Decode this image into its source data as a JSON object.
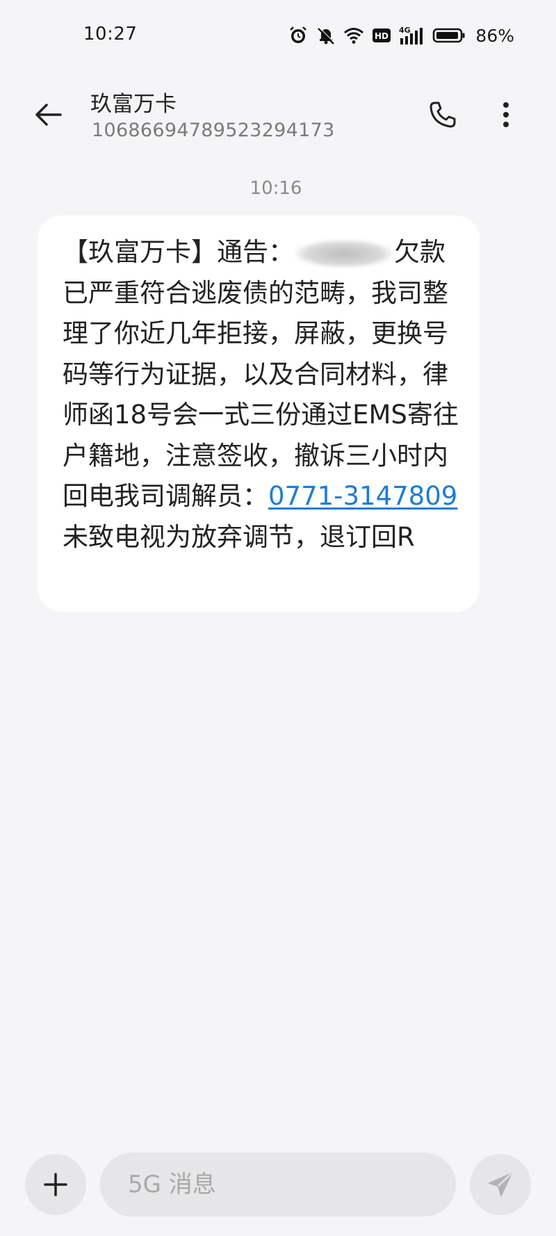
{
  "status_bar": {
    "time": "10:27",
    "battery_percent": "86%",
    "network_label": "4G",
    "hd_label": "HD",
    "icons": [
      "alarm-icon",
      "mute-icon",
      "wifi-icon",
      "hd-icon",
      "cellular-signal-icon",
      "battery-icon"
    ]
  },
  "header": {
    "title": "玖富万卡",
    "subtitle": "106866947895232941​73",
    "icons": [
      "back-arrow-icon",
      "phone-icon",
      "more-vertical-icon"
    ]
  },
  "conversation": {
    "timestamp": "10:16",
    "message": {
      "prefix": "【玖富万卡】通告：",
      "after_redaction": "欠款已严重符合逃废债的范畴，我司整理了你近几年拒接，屏蔽，更换号码等行为证据，以及合同材料，律师函18号会一式三份通过EMS寄往户籍地，注意签收，撤诉三小时内回电我司调解员：",
      "phone_link": "0771-3147809",
      "suffix": "未致电视为放弃调节，退订回R"
    }
  },
  "input_bar": {
    "placeholder": "5G 消息",
    "icons": [
      "plus-icon",
      "send-icon"
    ]
  },
  "colors": {
    "background": "#f5f5f7",
    "bubble": "#ffffff",
    "link": "#1c7cd6",
    "subtitle": "#7a7a7a"
  }
}
